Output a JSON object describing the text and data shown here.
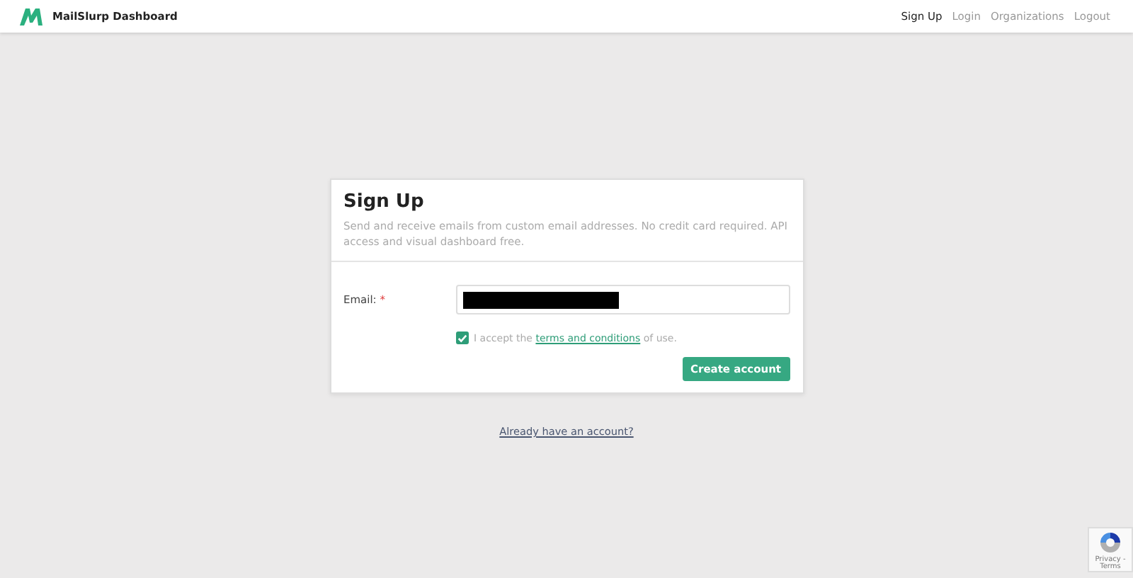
{
  "header": {
    "brand": "MailSlurp Dashboard",
    "nav": [
      {
        "label": "Sign Up",
        "selected": true
      },
      {
        "label": "Login",
        "selected": false
      },
      {
        "label": "Organizations",
        "selected": false
      },
      {
        "label": "Logout",
        "selected": false
      }
    ]
  },
  "card": {
    "title": "Sign Up",
    "description": "Send and receive emails from custom email addresses. No credit card required. API access and visual dashboard free.",
    "email_label": "Email:",
    "required_mark": "*",
    "terms": {
      "checked": true,
      "before": "I accept the",
      "link": "terms and conditions",
      "after": "of use."
    },
    "submit": "Create account"
  },
  "login_link": "Already have an account?",
  "recaptcha": {
    "links": "Privacy - Terms"
  }
}
